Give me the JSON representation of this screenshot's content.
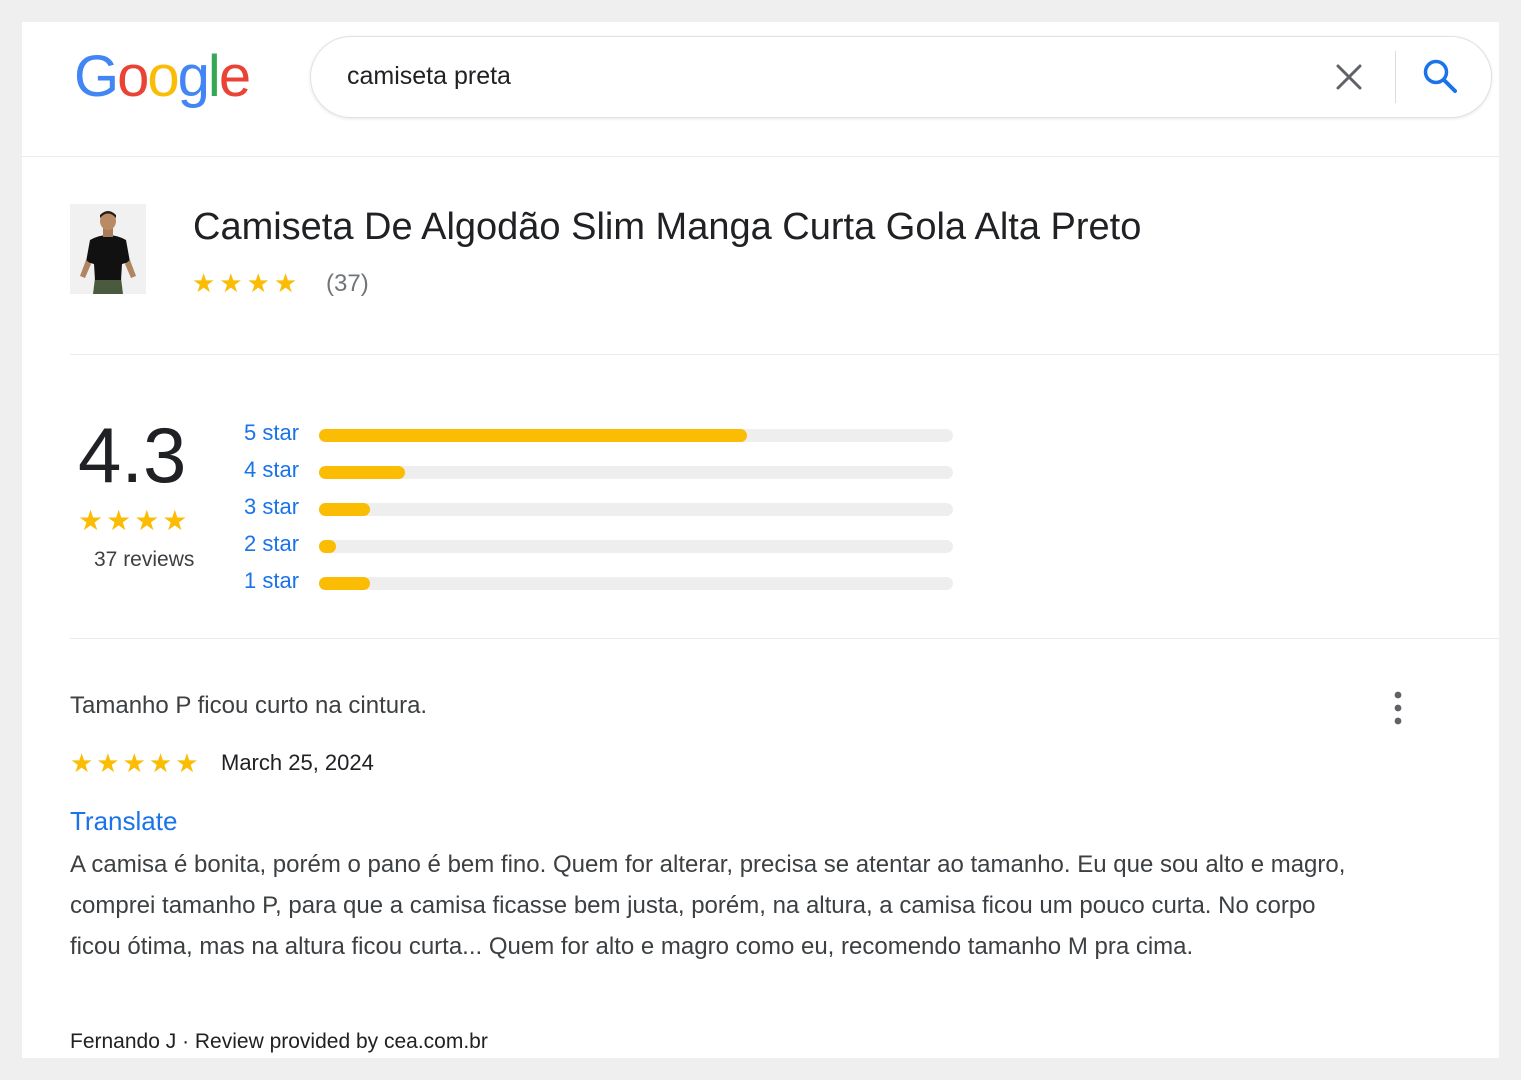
{
  "logo": {
    "letters": [
      {
        "char": "G",
        "color": "#4285F4"
      },
      {
        "char": "o",
        "color": "#EA4335"
      },
      {
        "char": "o",
        "color": "#FBBC05"
      },
      {
        "char": "g",
        "color": "#4285F4"
      },
      {
        "char": "l",
        "color": "#34A853"
      },
      {
        "char": "e",
        "color": "#EA4335"
      }
    ]
  },
  "search": {
    "query": "camiseta preta",
    "clear_icon": "close-icon",
    "search_icon": "search-icon"
  },
  "product": {
    "title": "Camiseta De Algodão Slim Manga Curta Gola Alta Preto",
    "stars": "★★★★",
    "review_count": "(37)"
  },
  "summary": {
    "rating": "4.3",
    "stars": "★★★★",
    "reviews_label": "37 reviews"
  },
  "distribution": [
    {
      "label": "5 star",
      "fraction": 0.675
    },
    {
      "label": "4 star",
      "fraction": 0.135
    },
    {
      "label": "3 star",
      "fraction": 0.08
    },
    {
      "label": "2 star",
      "fraction": 0.027
    },
    {
      "label": "1 star",
      "fraction": 0.08
    }
  ],
  "review": {
    "title": "Tamanho P ficou curto na cintura.",
    "stars": "★★★★★",
    "date": "March 25, 2024",
    "translate_label": "Translate",
    "body": "A camisa é bonita, porém o pano é bem fino. Quem for alterar, precisa se atentar ao tamanho. Eu que sou alto e magro, comprei tamanho P, para que a camisa ficasse bem justa, porém, na altura, a camisa ficou um pouco curta. No corpo ficou ótima, mas na altura ficou curta... Quem for alto e magro como eu, recomendo tamanho M pra cima.",
    "footer": "Fernando J · Review provided by cea.com.br",
    "more_icon": "more-vert-icon"
  },
  "colors": {
    "star": "#fbbc04",
    "link": "#1a73e8",
    "track": "#eeeeee"
  }
}
